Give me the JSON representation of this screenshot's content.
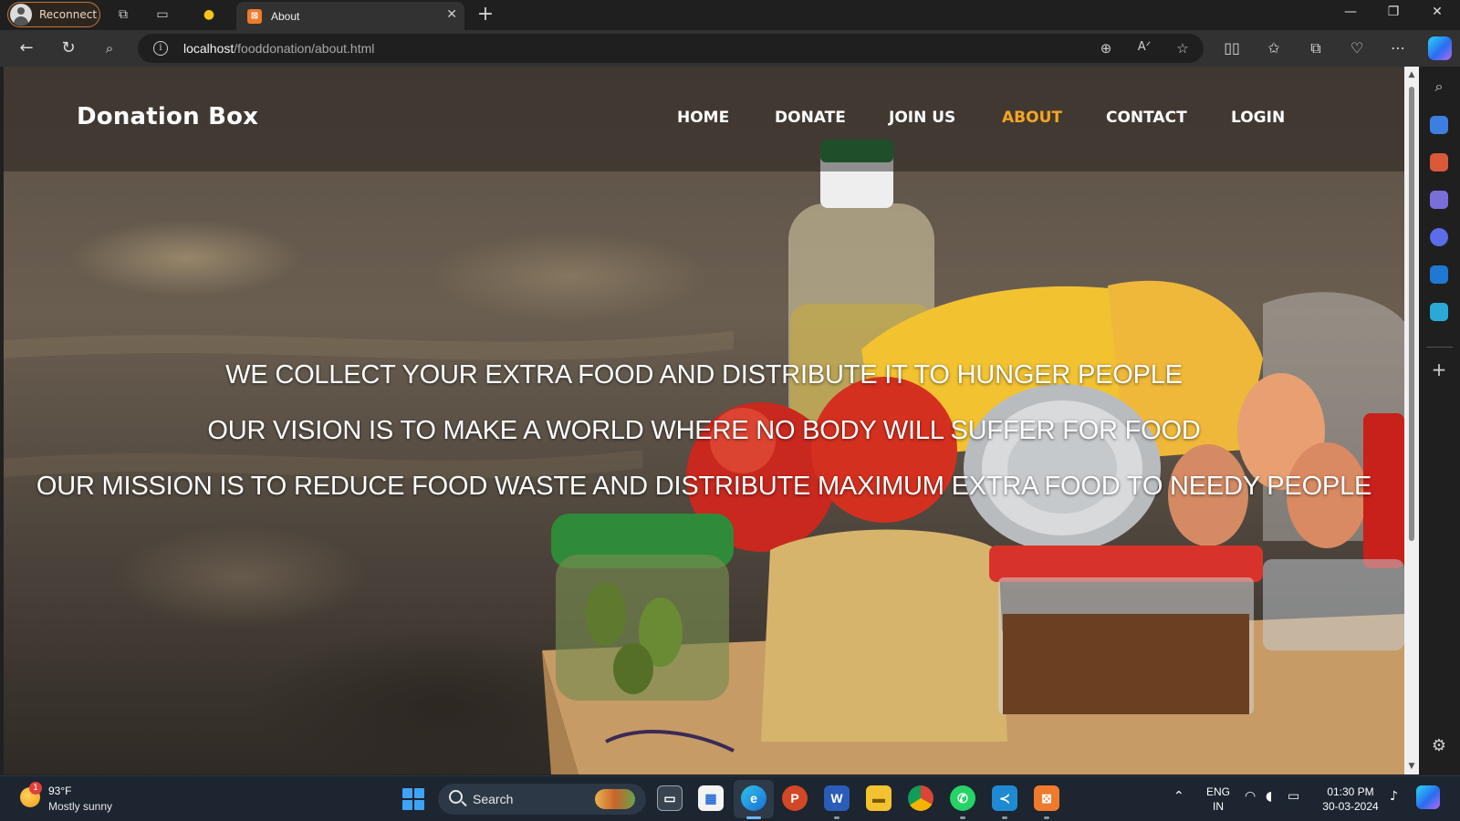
{
  "browser": {
    "profile_label": "Reconnect",
    "tab_title": "About",
    "tab_favicon": "XAMPP",
    "url_host": "localhost",
    "url_path": "/fooddonation/about.html"
  },
  "site": {
    "logo": "Donation Box",
    "nav": [
      {
        "label": "HOME"
      },
      {
        "label": "DONATE"
      },
      {
        "label": "JOIN US"
      },
      {
        "label": "ABOUT",
        "active": true
      },
      {
        "label": "CONTACT"
      },
      {
        "label": "LOGIN"
      }
    ],
    "hero_lines": [
      "WE COLLECT YOUR EXTRA FOOD AND DISTRIBUTE IT TO HUNGER PEOPLE",
      "OUR VISION IS TO MAKE A WORLD WHERE NO BODY WILL SUFFER FOR FOOD",
      "OUR MISSION IS TO REDUCE FOOD WASTE AND DISTRIBUTE MAXIMUM EXTRA FOOD TO NEEDY PEOPLE"
    ],
    "active_color": "#f5a524"
  },
  "taskbar": {
    "weather_badge": "1",
    "temperature": "93°F",
    "weather": "Mostly sunny",
    "search_label": "Search",
    "language_top": "ENG",
    "language_bottom": "IN",
    "time": "01:30 PM",
    "date": "30-03-2024"
  }
}
